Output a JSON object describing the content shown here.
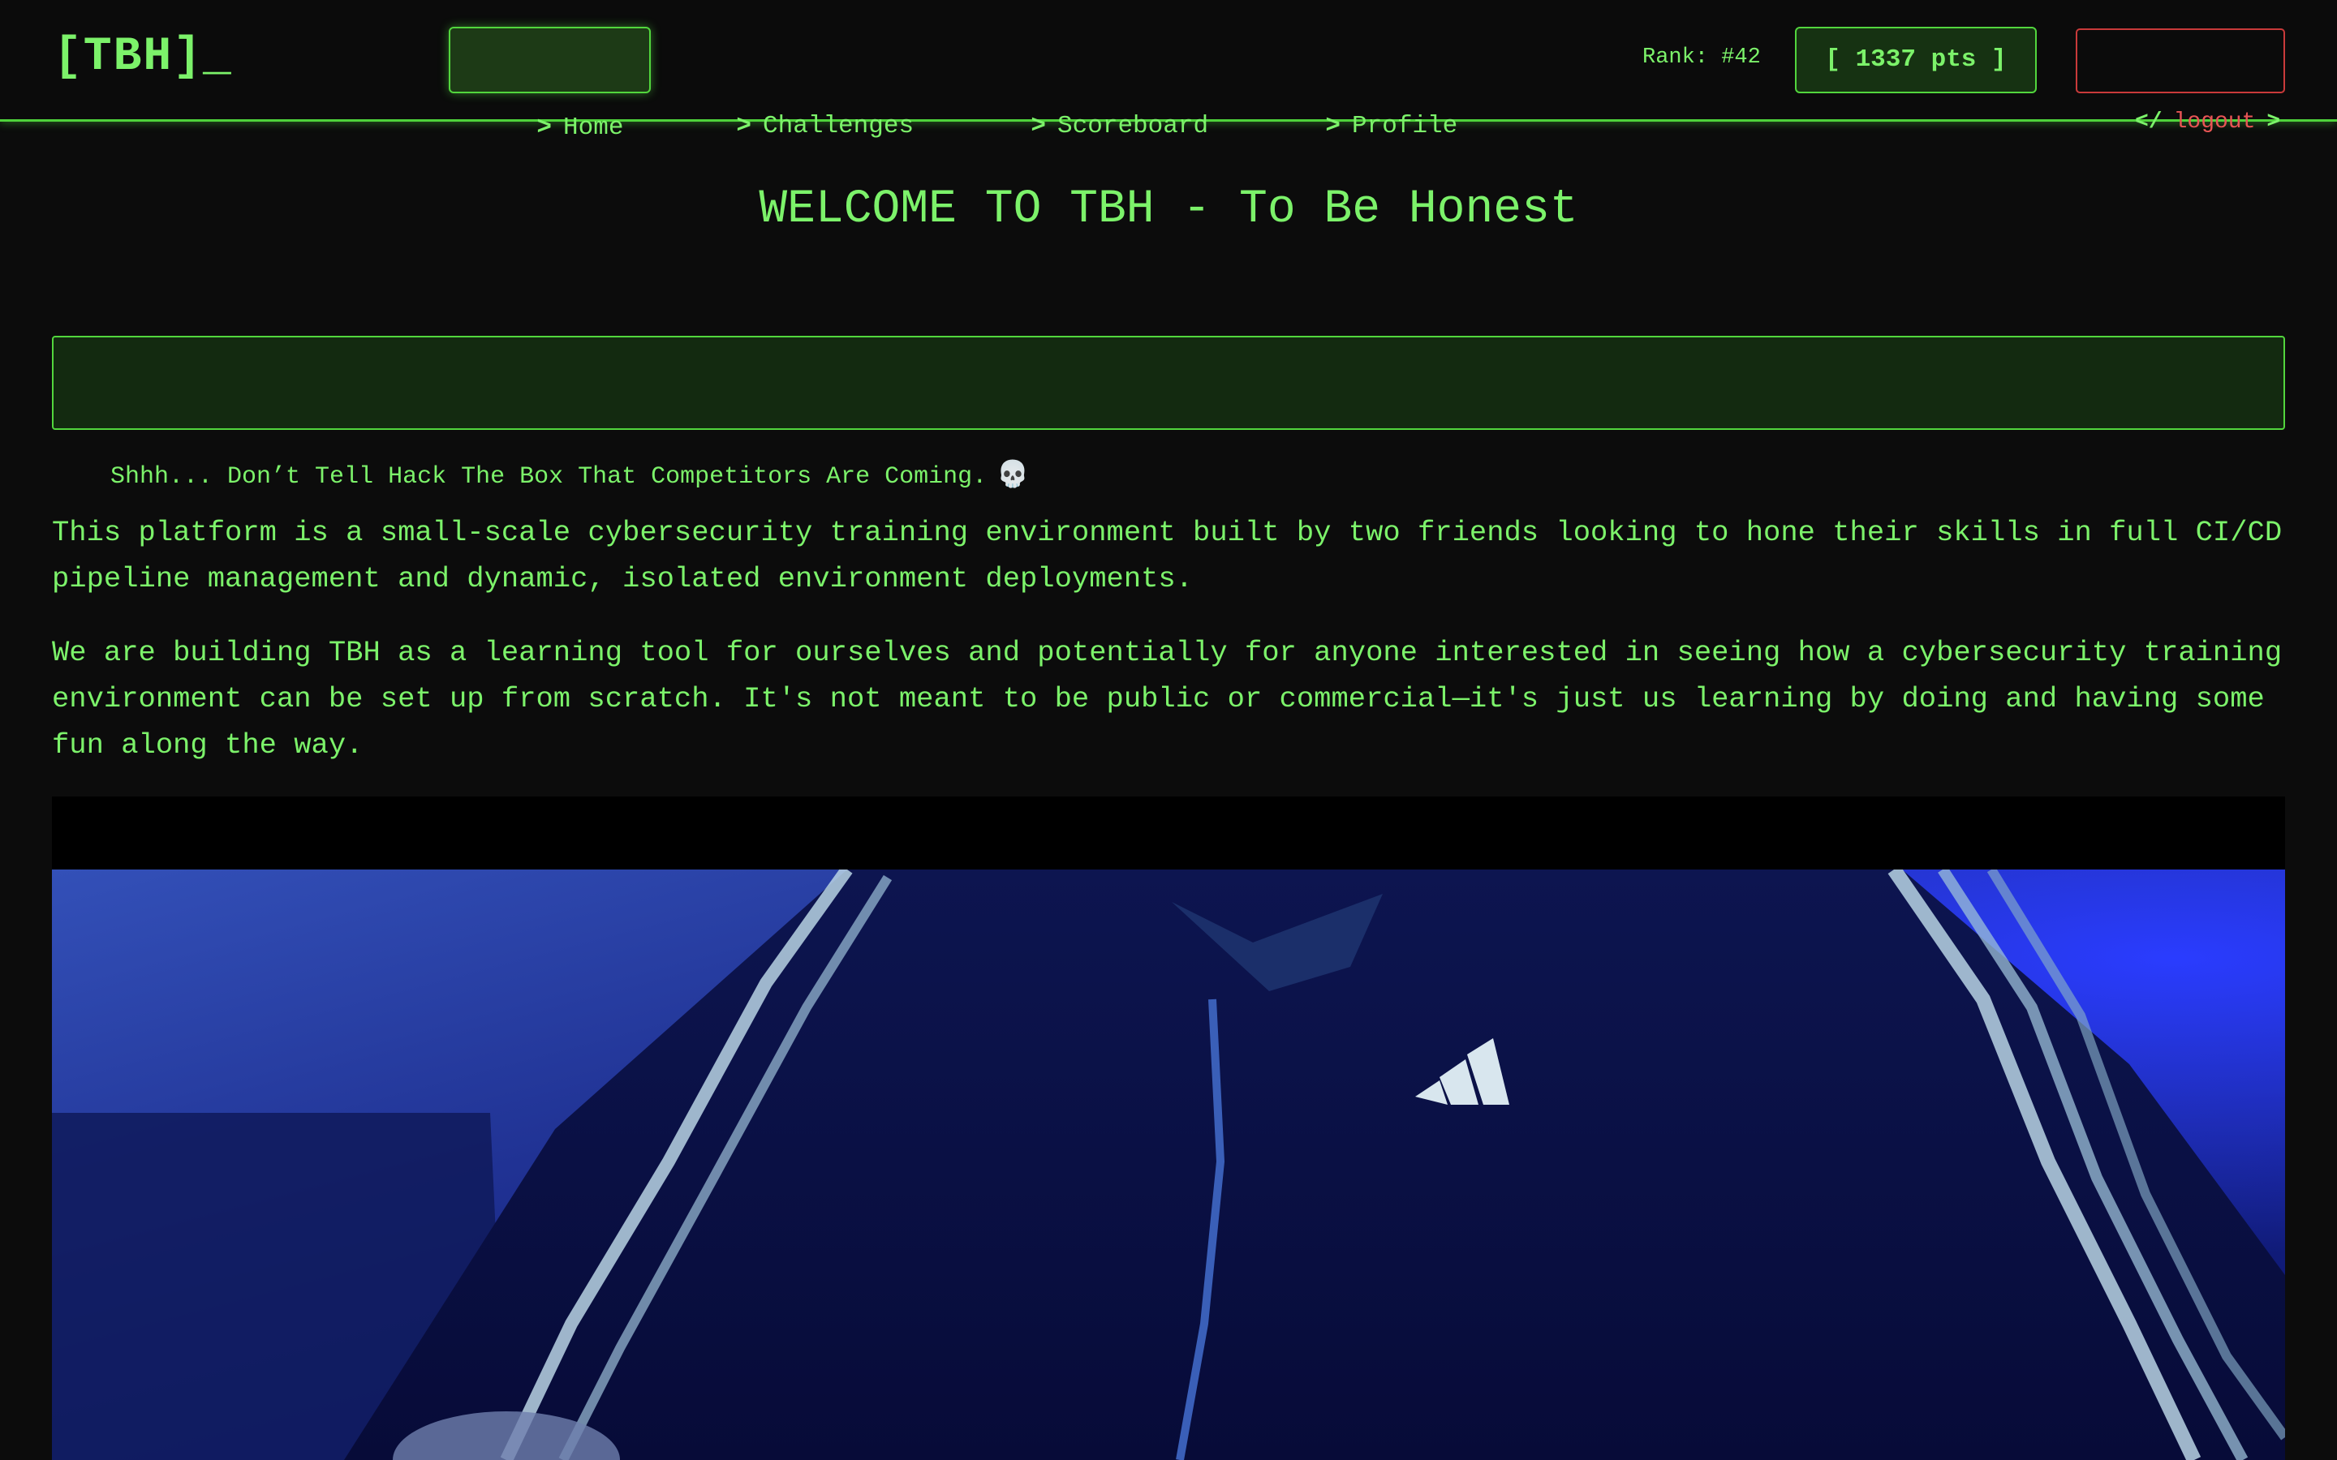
{
  "header": {
    "logo": "[TBH]_",
    "nav": [
      {
        "chevron": ">",
        "label": "Home",
        "active": true
      },
      {
        "chevron": ">",
        "label": "Challenges",
        "active": false
      },
      {
        "chevron": ">",
        "label": "Scoreboard",
        "active": false
      },
      {
        "chevron": ">",
        "label": "Profile",
        "active": false
      }
    ],
    "rank": "Rank: #42",
    "points": "[ 1337 pts ]",
    "logout": {
      "open": "</",
      "label": "logout",
      "close": ">"
    }
  },
  "main": {
    "title": "WELCOME TO TBH - To Be Honest",
    "notice": {
      "text": "Shhh... Don’t Tell Hack The Box That Competitors Are Coming.",
      "emoji": "💀"
    },
    "paragraphs": [
      "This platform is a small-scale cybersecurity training environment built by two friends looking to hone their skills in full CI/CD pipeline management and dynamic, isolated environment deployments.",
      "We are building TBH as a learning tool for ourselves and potentially for anyone interested in seeing how a cybersecurity training environment can be set up from scratch. It's not meant to be public or commercial—it's just us learning by doing and having some fun along the way."
    ],
    "media": {
      "icon": "hacker-in-hoodie-gif"
    }
  },
  "colors": {
    "accent": "#7cf26a",
    "border": "#52d63d",
    "background": "#0c0c0c",
    "danger": "#e85555"
  }
}
